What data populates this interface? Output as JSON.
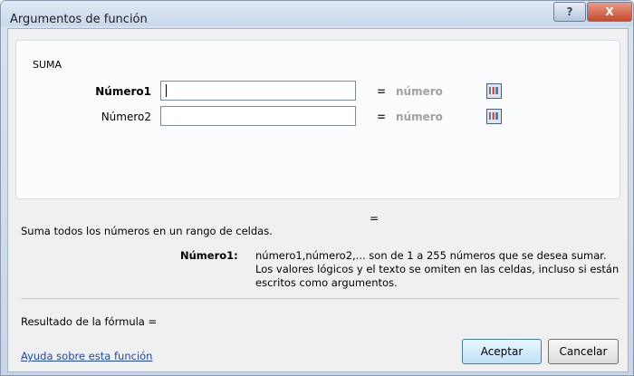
{
  "window": {
    "title": "Argumentos de función",
    "help_button": "?",
    "close_button": "X"
  },
  "function_group": {
    "name": "SUMA",
    "arguments": [
      {
        "label": "Número1",
        "value": "",
        "result": "número",
        "bold": true
      },
      {
        "label": "Número2",
        "value": "",
        "result": "número",
        "bold": false
      }
    ],
    "formula_equals": "="
  },
  "description": "Suma todos los números en un rango de celdas.",
  "argument_help": {
    "name": "Número1:",
    "text": "número1,número2,... son de 1 a 255 números que se desea sumar. Los valores lógicos y el texto se omiten en las celdas, incluso si están escritos como argumentos."
  },
  "result": {
    "label": "Resultado de la fórmula ="
  },
  "footer": {
    "help_link": "Ayuda sobre esta función",
    "ok_button": "Aceptar",
    "cancel_button": "Cancelar"
  }
}
